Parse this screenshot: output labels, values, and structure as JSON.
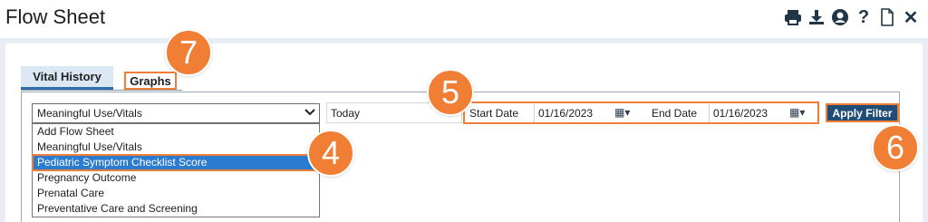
{
  "header": {
    "title": "Flow Sheet",
    "icons": [
      "print-icon",
      "download-icon",
      "user-circle-icon",
      "help-icon",
      "document-icon",
      "close-icon"
    ]
  },
  "tabs": [
    {
      "label": "Vital History",
      "active": true
    },
    {
      "label": "Graphs",
      "active": false
    }
  ],
  "filter": {
    "selected": "Meaningful Use/Vitals",
    "options": [
      "Add Flow Sheet",
      "Meaningful Use/Vitals",
      "Pediatric Symptom Checklist Score",
      "Pregnancy Outcome",
      "Prenatal Care",
      "Preventative Care and Screening"
    ],
    "highlighted_option": "Pediatric Symptom Checklist Score",
    "range_preset": "Today",
    "start_label": "Start Date",
    "start_value": "01/16/2023",
    "end_label": "End Date",
    "end_value": "01/16/2023",
    "apply_label": "Apply Filter"
  },
  "callouts": [
    "7",
    "5",
    "4",
    "6"
  ],
  "colors": {
    "callout": "#f07f35",
    "primary_button": "#1f4d77",
    "selected_option": "#2b7bd1"
  }
}
